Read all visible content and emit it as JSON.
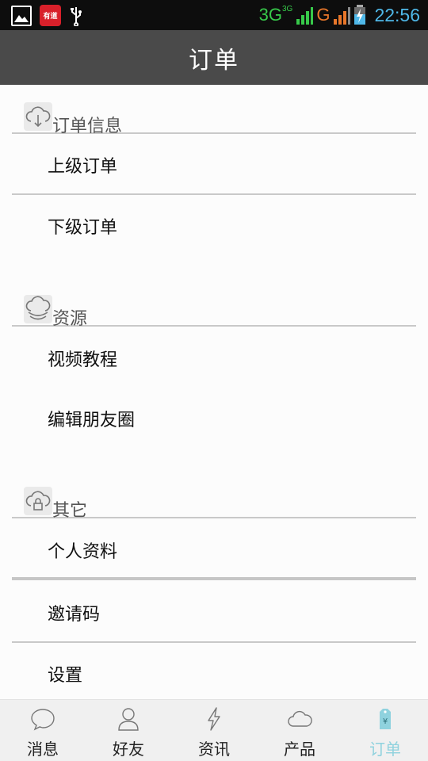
{
  "status_bar": {
    "network1": "3G",
    "network1_sup": "3G",
    "network2": "G",
    "time": "22:56",
    "app_badge": "有道"
  },
  "title": "订单",
  "sections": [
    {
      "title": "订单信息",
      "icon": "cloud-download-icon",
      "items": [
        "上级订单",
        "下级订单"
      ]
    },
    {
      "title": "资源",
      "icon": "cloud-wave-icon",
      "items": [
        "视频教程",
        "编辑朋友圈"
      ]
    },
    {
      "title": "其它",
      "icon": "cloud-lock-icon",
      "items": [
        "个人资料",
        "邀请码",
        "设置"
      ]
    }
  ],
  "nav": [
    {
      "label": "消息",
      "icon": "chat-bubble-icon",
      "active": false
    },
    {
      "label": "好友",
      "icon": "person-icon",
      "active": false
    },
    {
      "label": "资讯",
      "icon": "lightning-icon",
      "active": false
    },
    {
      "label": "产品",
      "icon": "cloud-icon",
      "active": false
    },
    {
      "label": "订单",
      "icon": "yuan-tag-icon",
      "active": true
    }
  ],
  "colors": {
    "title_bar": "#4a4a4a",
    "active_nav": "#8fd2de",
    "time": "#4fb8e8",
    "network_green": "#37c94a",
    "network_orange": "#e8772a"
  }
}
